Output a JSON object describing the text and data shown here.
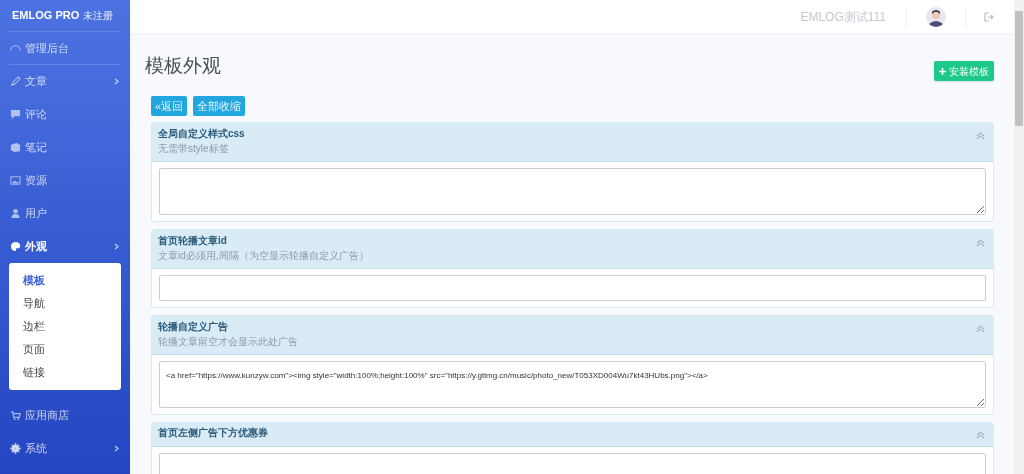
{
  "brand": {
    "name": "EMLOG PRO",
    "tag": "未注册"
  },
  "sidebar": {
    "items": [
      {
        "label": "管理后台",
        "arrow": false,
        "expanded": false
      },
      {
        "label": "文章",
        "arrow": true,
        "expanded": false
      },
      {
        "label": "评论",
        "arrow": false,
        "expanded": false
      },
      {
        "label": "笔记",
        "arrow": false,
        "expanded": false
      },
      {
        "label": "资源",
        "arrow": false,
        "expanded": false
      },
      {
        "label": "用户",
        "arrow": false,
        "expanded": false
      },
      {
        "label": "外观",
        "arrow": true,
        "expanded": true,
        "children": [
          {
            "label": "模板",
            "selected": true
          },
          {
            "label": "导航",
            "selected": false
          },
          {
            "label": "边栏",
            "selected": false
          },
          {
            "label": "页面",
            "selected": false
          },
          {
            "label": "链接",
            "selected": false
          }
        ]
      },
      {
        "label": "应用商店",
        "arrow": false,
        "expanded": false
      },
      {
        "label": "系统",
        "arrow": true,
        "expanded": false
      }
    ]
  },
  "header": {
    "username": "EMLOG测试111"
  },
  "page": {
    "title": "模板外观",
    "install_button": "安装模板",
    "buttons": [
      "«返回",
      "全部收缩"
    ]
  },
  "panels": [
    {
      "title": "全局自定义样式css",
      "hint": "无需带style标签",
      "kind": "textarea"
    },
    {
      "title": "首页轮播文章id",
      "hint": "文章id必须用,间隔（为空显示轮播自定义广告）",
      "kind": "input"
    },
    {
      "title": "轮播自定义广告",
      "hint": "轮播文章留空才会显示此处广告",
      "kind": "textarea",
      "value": "<a href=\"https://www.kunzyw.com\"><img style=\"width:100%;height:100%\" src=\"https://y.gtimg.cn/music/photo_new/T053XD004Wu7kt43HUbs.png\"></a>"
    },
    {
      "title": "首页左侧广告下方优惠券",
      "kind": "textarea"
    }
  ]
}
